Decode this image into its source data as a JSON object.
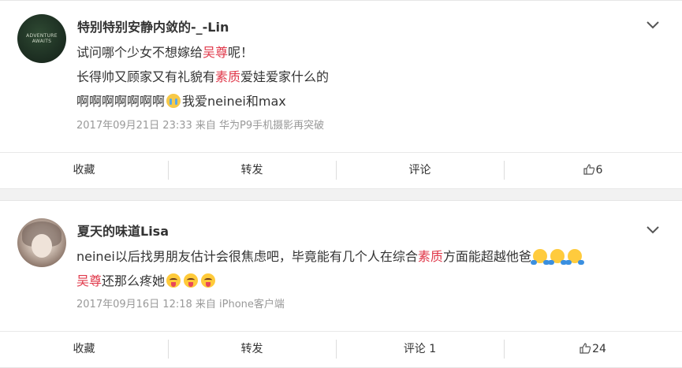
{
  "posts": [
    {
      "username": "特别特别安静内敛的-_-Lin",
      "avatar_text": "ADVENTURE AWAITS",
      "lines": [
        {
          "parts": [
            {
              "t": "试问哪个少女不想嫁给"
            },
            {
              "t": "吴尊",
              "hl": true
            },
            {
              "t": "呢！"
            }
          ]
        },
        {
          "parts": [
            {
              "t": "长得帅又顾家又有礼貌有"
            },
            {
              "t": "素质",
              "hl": true
            },
            {
              "t": "爱娃爱家什么的"
            }
          ]
        },
        {
          "parts": [
            {
              "t": "啊啊啊啊啊啊啊"
            },
            {
              "emoji": "crying-emoji"
            },
            {
              "t": "我爱neinei和max"
            }
          ]
        }
      ],
      "meta": "2017年09月21日 23:33 来自 华为P9手机摄影再突破",
      "actions": {
        "favorite": "收藏",
        "repost": "转发",
        "comment": "评论",
        "like_count": "6"
      }
    },
    {
      "username": "夏天的味道Lisa",
      "lines": [
        {
          "parts": [
            {
              "t": "neinei以后找男朋友估计会很焦虑吧，毕竟能有几个人在综合"
            },
            {
              "t": "素质",
              "hl": true
            },
            {
              "t": "方面能超越他爸"
            },
            {
              "emoji": "hug-emoji"
            },
            {
              "emoji": "hug-emoji"
            },
            {
              "emoji": "hug-emoji"
            }
          ]
        },
        {
          "parts": [
            {
              "t": "吴尊",
              "hl": true
            },
            {
              "t": "还那么疼她"
            },
            {
              "emoji": "tongue-emoji"
            },
            {
              "emoji": "tongue-emoji"
            },
            {
              "emoji": "tongue-emoji"
            }
          ]
        }
      ],
      "meta": "2017年09月16日 12:18 来自 iPhone客户端",
      "actions": {
        "favorite": "收藏",
        "repost": "转发",
        "comment": "评论 1",
        "like_count": "24"
      }
    }
  ],
  "colors": {
    "highlight": "#e0384a",
    "meta": "#999999",
    "text": "#333333"
  }
}
